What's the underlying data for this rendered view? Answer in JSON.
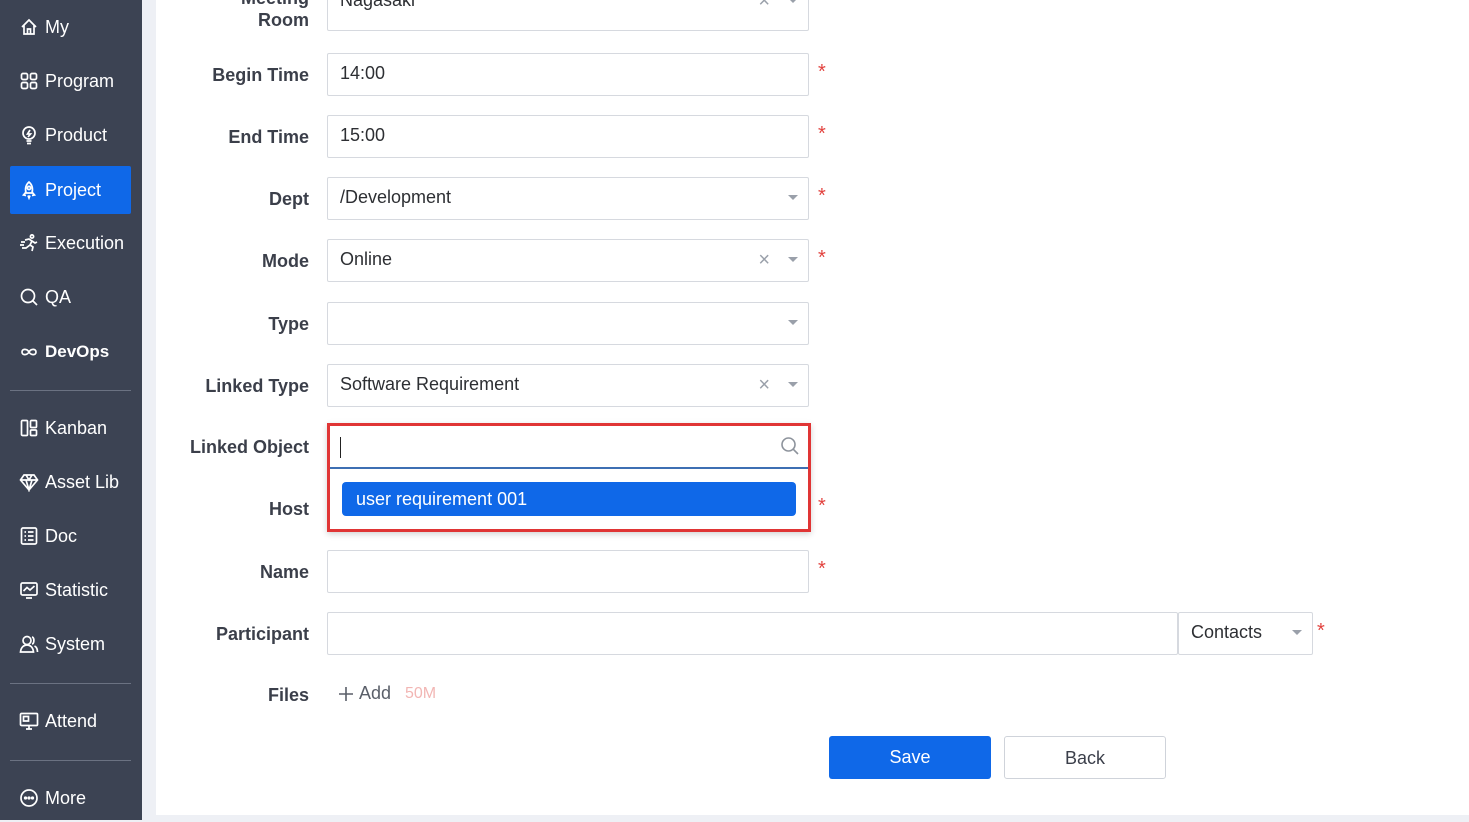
{
  "nav": {
    "items": [
      {
        "label": "My",
        "icon": "home-icon"
      },
      {
        "label": "Program",
        "icon": "grid-icon"
      },
      {
        "label": "Product",
        "icon": "bulb-icon"
      },
      {
        "label": "Project",
        "icon": "rocket-icon"
      },
      {
        "label": "Execution",
        "icon": "run-icon"
      },
      {
        "label": "QA",
        "icon": "magnifier-icon"
      },
      {
        "label": "DevOps",
        "icon": "infinity-icon"
      },
      {
        "label": "Kanban",
        "icon": "kanban-icon"
      },
      {
        "label": "Asset Lib",
        "icon": "diamond-icon"
      },
      {
        "label": "Doc",
        "icon": "doc-icon"
      },
      {
        "label": "Statistic",
        "icon": "chart-icon"
      },
      {
        "label": "System",
        "icon": "users-icon"
      },
      {
        "label": "Attend",
        "icon": "attend-icon"
      },
      {
        "label": "More",
        "icon": "more-icon"
      }
    ],
    "active": "Project",
    "active_color": "#0f68e8"
  },
  "form": {
    "meeting_room": {
      "label_line1": "Meeting",
      "label_line2": "Room",
      "value": "Nagasaki"
    },
    "begin_time": {
      "label": "Begin Time",
      "value": "14:00"
    },
    "end_time": {
      "label": "End Time",
      "value": "15:00"
    },
    "dept": {
      "label": "Dept",
      "value": "/Development"
    },
    "mode": {
      "label": "Mode",
      "value": "Online"
    },
    "type": {
      "label": "Type",
      "value": ""
    },
    "linked_type": {
      "label": "Linked Type",
      "value": "Software Requirement"
    },
    "linked_object": {
      "label": "Linked Object",
      "search_value": "",
      "option": "user requirement 001"
    },
    "host": {
      "label": "Host"
    },
    "name": {
      "label": "Name",
      "value": ""
    },
    "participant": {
      "label": "Participant",
      "value": "",
      "contacts_label": "Contacts"
    },
    "files": {
      "label": "Files",
      "add_label": "Add",
      "limit": "50M"
    },
    "required_mark": "*",
    "clear_glyph": "×"
  },
  "buttons": {
    "save": "Save",
    "back": "Back"
  }
}
